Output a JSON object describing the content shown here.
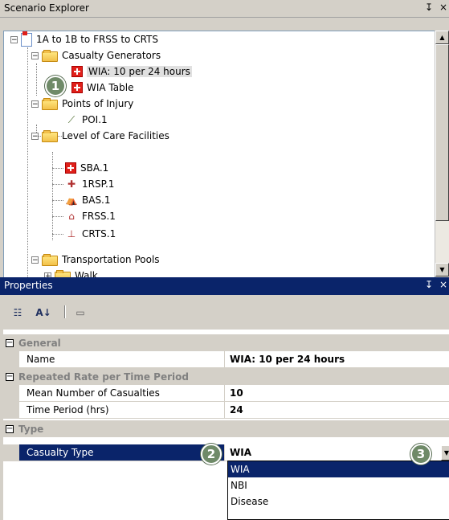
{
  "explorer": {
    "title": "Scenario Explorer",
    "pin_glyph": "↧",
    "close_glyph": "×",
    "tree": {
      "root": "1A to 1B to FRSS to CRTS",
      "casualty_generators": "Casualty Generators",
      "wia_generator": "WIA: 10 per 24 hours",
      "wia_table": "WIA Table",
      "points_of_injury": "Points of Injury",
      "poi": "POI.1",
      "level_of_care": "Level of Care Facilities",
      "sba": "SBA.1",
      "rsp": "1RSP.1",
      "bas": "BAS.1",
      "frss": "FRSS.1",
      "crts": "CRTS.1",
      "transportation_pools": "Transportation Pools",
      "walk": "Walk"
    }
  },
  "properties": {
    "title": "Properties",
    "pin_glyph": "↧",
    "close_glyph": "×",
    "toolbar": {
      "categorized_glyph": "☷",
      "alphabetical_glyph": "A↓",
      "pages_glyph": "▭"
    },
    "categories": {
      "general": "General",
      "rate": "Repeated Rate per Time Period",
      "type": "Type"
    },
    "rows": {
      "name_label": "Name",
      "name_value": "WIA: 10 per 24 hours",
      "mean_label": "Mean Number of Casualties",
      "mean_value": "10",
      "period_label": "Time Period (hrs)",
      "period_value": "24",
      "casualty_label": "Casualty Type",
      "casualty_value": "WIA"
    },
    "casualty_options": [
      "WIA",
      "NBI",
      "Disease"
    ]
  },
  "callouts": [
    "1",
    "2",
    "3"
  ]
}
